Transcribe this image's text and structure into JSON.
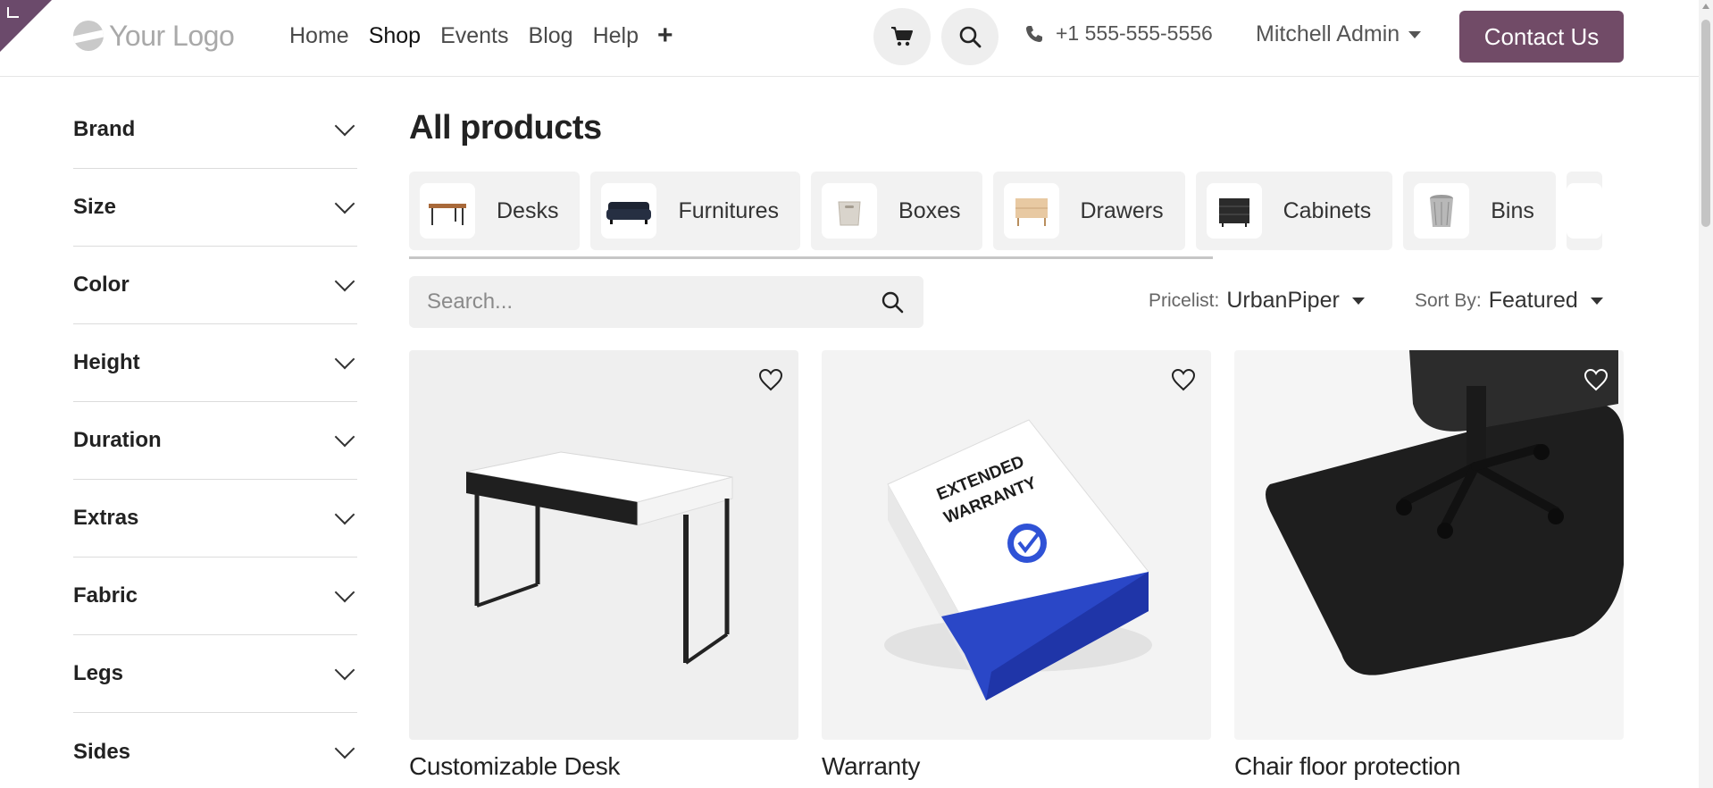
{
  "header": {
    "logo_text": "Your Logo",
    "nav": [
      "Home",
      "Shop",
      "Events",
      "Blog",
      "Help"
    ],
    "nav_active": "Shop",
    "add_menu_glyph": "+",
    "phone": "+1 555-555-5556",
    "user_name": "Mitchell Admin",
    "contact_button": "Contact Us",
    "brand_color": "#714b67"
  },
  "sidebar": {
    "filters": [
      "Brand",
      "Size",
      "Color",
      "Height",
      "Duration",
      "Extras",
      "Fabric",
      "Legs",
      "Sides"
    ]
  },
  "main": {
    "title": "All products",
    "categories": [
      "Desks",
      "Furnitures",
      "Boxes",
      "Drawers",
      "Cabinets",
      "Bins"
    ],
    "search_placeholder": "Search...",
    "pricelist_label": "Pricelist:",
    "pricelist_value": "UrbanPiper",
    "sort_label": "Sort By:",
    "sort_value": "Featured",
    "products": [
      {
        "name": "Customizable Desk",
        "image": "white-desk"
      },
      {
        "name": "Warranty",
        "image": "extended-warranty-box"
      },
      {
        "name": "Chair floor protection",
        "image": "chair-mat"
      }
    ],
    "warranty_box_text_1": "EXTENDED",
    "warranty_box_text_2": "WARRANTY"
  }
}
